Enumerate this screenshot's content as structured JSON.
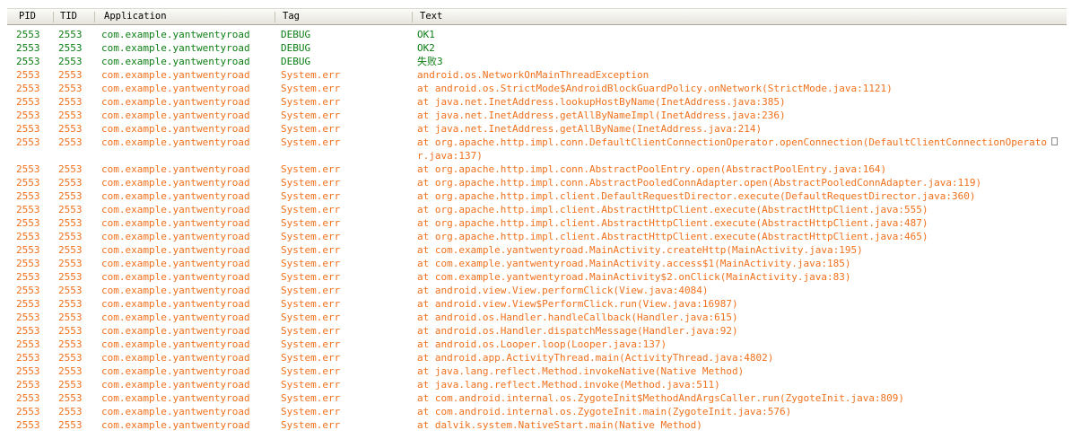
{
  "columns": {
    "pid": "PID",
    "tid": "TID",
    "application": "Application",
    "tag": "Tag",
    "text": "Text"
  },
  "rows": [
    {
      "level": "debug",
      "pid": "2553",
      "tid": "2553",
      "app": "com.example.yantwentyroad",
      "tag": "DEBUG",
      "text": "OK1"
    },
    {
      "level": "debug",
      "pid": "2553",
      "tid": "2553",
      "app": "com.example.yantwentyroad",
      "tag": "DEBUG",
      "text": "OK2"
    },
    {
      "level": "debug",
      "pid": "2553",
      "tid": "2553",
      "app": "com.example.yantwentyroad",
      "tag": "DEBUG",
      "text": "失败3"
    },
    {
      "level": "error",
      "pid": "2553",
      "tid": "2553",
      "app": "com.example.yantwentyroad",
      "tag": "System.err",
      "text": "android.os.NetworkOnMainThreadException"
    },
    {
      "level": "error",
      "pid": "2553",
      "tid": "2553",
      "app": "com.example.yantwentyroad",
      "tag": "System.err",
      "text": "at android.os.StrictMode$AndroidBlockGuardPolicy.onNetwork(StrictMode.java:1121)"
    },
    {
      "level": "error",
      "pid": "2553",
      "tid": "2553",
      "app": "com.example.yantwentyroad",
      "tag": "System.err",
      "text": "at java.net.InetAddress.lookupHostByName(InetAddress.java:385)"
    },
    {
      "level": "error",
      "pid": "2553",
      "tid": "2553",
      "app": "com.example.yantwentyroad",
      "tag": "System.err",
      "text": "at java.net.InetAddress.getAllByNameImpl(InetAddress.java:236)"
    },
    {
      "level": "error",
      "pid": "2553",
      "tid": "2553",
      "app": "com.example.yantwentyroad",
      "tag": "System.err",
      "text": "at java.net.InetAddress.getAllByName(InetAddress.java:214)"
    },
    {
      "level": "error",
      "pid": "2553",
      "tid": "2553",
      "app": "com.example.yantwentyroad",
      "tag": "System.err",
      "text": "at org.apache.http.impl.conn.DefaultClientConnectionOperator.openConnection(DefaultClientConnectionOperator.java:137)",
      "wrapped": true
    },
    {
      "level": "error",
      "pid": "2553",
      "tid": "2553",
      "app": "com.example.yantwentyroad",
      "tag": "System.err",
      "text": "at org.apache.http.impl.conn.AbstractPoolEntry.open(AbstractPoolEntry.java:164)"
    },
    {
      "level": "error",
      "pid": "2553",
      "tid": "2553",
      "app": "com.example.yantwentyroad",
      "tag": "System.err",
      "text": "at org.apache.http.impl.conn.AbstractPooledConnAdapter.open(AbstractPooledConnAdapter.java:119)"
    },
    {
      "level": "error",
      "pid": "2553",
      "tid": "2553",
      "app": "com.example.yantwentyroad",
      "tag": "System.err",
      "text": "at org.apache.http.impl.client.DefaultRequestDirector.execute(DefaultRequestDirector.java:360)"
    },
    {
      "level": "error",
      "pid": "2553",
      "tid": "2553",
      "app": "com.example.yantwentyroad",
      "tag": "System.err",
      "text": "at org.apache.http.impl.client.AbstractHttpClient.execute(AbstractHttpClient.java:555)"
    },
    {
      "level": "error",
      "pid": "2553",
      "tid": "2553",
      "app": "com.example.yantwentyroad",
      "tag": "System.err",
      "text": "at org.apache.http.impl.client.AbstractHttpClient.execute(AbstractHttpClient.java:487)"
    },
    {
      "level": "error",
      "pid": "2553",
      "tid": "2553",
      "app": "com.example.yantwentyroad",
      "tag": "System.err",
      "text": "at org.apache.http.impl.client.AbstractHttpClient.execute(AbstractHttpClient.java:465)"
    },
    {
      "level": "error",
      "pid": "2553",
      "tid": "2553",
      "app": "com.example.yantwentyroad",
      "tag": "System.err",
      "text": "at com.example.yantwentyroad.MainActivity.createHttp(MainActivity.java:195)"
    },
    {
      "level": "error",
      "pid": "2553",
      "tid": "2553",
      "app": "com.example.yantwentyroad",
      "tag": "System.err",
      "text": "at com.example.yantwentyroad.MainActivity.access$1(MainActivity.java:185)"
    },
    {
      "level": "error",
      "pid": "2553",
      "tid": "2553",
      "app": "com.example.yantwentyroad",
      "tag": "System.err",
      "text": "at com.example.yantwentyroad.MainActivity$2.onClick(MainActivity.java:83)"
    },
    {
      "level": "error",
      "pid": "2553",
      "tid": "2553",
      "app": "com.example.yantwentyroad",
      "tag": "System.err",
      "text": "at android.view.View.performClick(View.java:4084)"
    },
    {
      "level": "error",
      "pid": "2553",
      "tid": "2553",
      "app": "com.example.yantwentyroad",
      "tag": "System.err",
      "text": "at android.view.View$PerformClick.run(View.java:16987)"
    },
    {
      "level": "error",
      "pid": "2553",
      "tid": "2553",
      "app": "com.example.yantwentyroad",
      "tag": "System.err",
      "text": "at android.os.Handler.handleCallback(Handler.java:615)"
    },
    {
      "level": "error",
      "pid": "2553",
      "tid": "2553",
      "app": "com.example.yantwentyroad",
      "tag": "System.err",
      "text": "at android.os.Handler.dispatchMessage(Handler.java:92)"
    },
    {
      "level": "error",
      "pid": "2553",
      "tid": "2553",
      "app": "com.example.yantwentyroad",
      "tag": "System.err",
      "text": "at android.os.Looper.loop(Looper.java:137)"
    },
    {
      "level": "error",
      "pid": "2553",
      "tid": "2553",
      "app": "com.example.yantwentyroad",
      "tag": "System.err",
      "text": "at android.app.ActivityThread.main(ActivityThread.java:4802)"
    },
    {
      "level": "error",
      "pid": "2553",
      "tid": "2553",
      "app": "com.example.yantwentyroad",
      "tag": "System.err",
      "text": "at java.lang.reflect.Method.invokeNative(Native Method)"
    },
    {
      "level": "error",
      "pid": "2553",
      "tid": "2553",
      "app": "com.example.yantwentyroad",
      "tag": "System.err",
      "text": "at java.lang.reflect.Method.invoke(Method.java:511)"
    },
    {
      "level": "error",
      "pid": "2553",
      "tid": "2553",
      "app": "com.example.yantwentyroad",
      "tag": "System.err",
      "text": "at com.android.internal.os.ZygoteInit$MethodAndArgsCaller.run(ZygoteInit.java:809)"
    },
    {
      "level": "error",
      "pid": "2553",
      "tid": "2553",
      "app": "com.example.yantwentyroad",
      "tag": "System.err",
      "text": "at com.android.internal.os.ZygoteInit.main(ZygoteInit.java:576)"
    },
    {
      "level": "error",
      "pid": "2553",
      "tid": "2553",
      "app": "com.example.yantwentyroad",
      "tag": "System.err",
      "text": "at dalvik.system.NativeStart.main(Native Method)"
    }
  ],
  "colors": {
    "debug": "#0c7e14",
    "error": "#f0711d"
  }
}
